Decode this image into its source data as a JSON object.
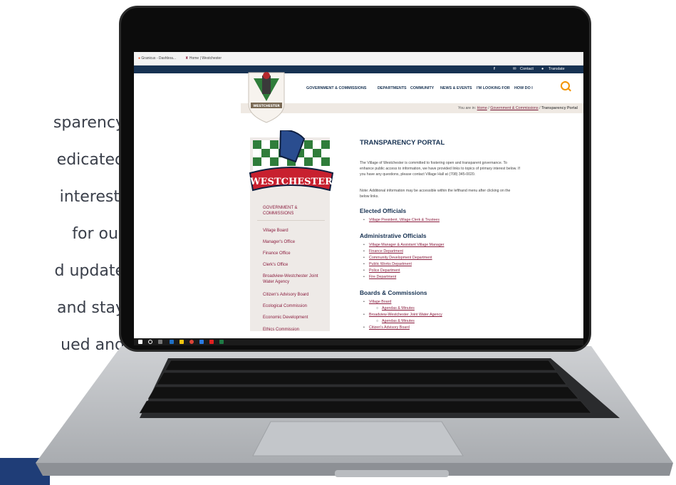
{
  "side_text": {
    "lines": [
      "sparency",
      "edicated",
      "interest,",
      "for our",
      "d update",
      "and stay",
      "ued and"
    ]
  },
  "browser": {
    "tabs": [
      {
        "label": "Granicus - Dashboa..."
      },
      {
        "label": "Home | Westchester"
      }
    ]
  },
  "site": {
    "topbar": {
      "facebook": "f",
      "contact": "Contact",
      "translate": "Translate"
    },
    "logo_text": "WESTCHESTER",
    "nav": [
      "GOVERNMENT & COMMISSIONS",
      "DEPARTMENTS",
      "COMMUNITY",
      "NEWS & EVENTS",
      "I'M LOOKING FOR",
      "HOW DO I"
    ],
    "breadcrumb": {
      "prefix": "You are in:",
      "home": "Home",
      "section": "Government & Commissions",
      "current": "Transparency Portal"
    },
    "sidebar_logo_text": "WESTCHESTER",
    "sidebar": {
      "heading": [
        "GOVERNMENT &",
        "COMMISSIONS"
      ],
      "items": [
        "Village Board",
        "Manager's Office",
        "Finance Office",
        "Clerk's Office",
        "Broadview-Westchester Joint",
        "Water Agency",
        "Citizen's Advisory Board",
        "Ecological Commission",
        "Economic Development",
        "Ethics Commission"
      ]
    },
    "content": {
      "title": "TRANSPARENCY PORTAL",
      "intro": [
        "The Village of Westchester is committed to fostering open and transparent governance. To",
        "enhance public access to information, we have provided links to topics of primary interest below. If",
        "you have any questions, please contact Village Hall at (708) 345-0020."
      ],
      "note": [
        "Note: Additional information may be accessible within the lefthand menu after clicking on the",
        "below links."
      ],
      "elected": {
        "heading": "Elected Officials",
        "links": [
          "Village President, Village Clerk & Trustees"
        ]
      },
      "administrative": {
        "heading": "Administrative Officials",
        "links": [
          "Village Manager & Assistant Village Manager",
          "Finance Department",
          "Community Development Department",
          "Public Works Department",
          "Police Department",
          "Fire Department"
        ]
      },
      "boards": {
        "heading": "Boards & Commissions",
        "links": [
          "Village Board",
          "Agendas & Minutes",
          "Broadview-Westchester Joint Water Agency",
          "Agendas & Minutes",
          "Citizen's Advisory Board"
        ]
      }
    }
  },
  "colors": {
    "navy": "#173252",
    "maroon": "#8b1e3f",
    "crumb_bg": "#efe9e3",
    "accent": "#f29400"
  }
}
